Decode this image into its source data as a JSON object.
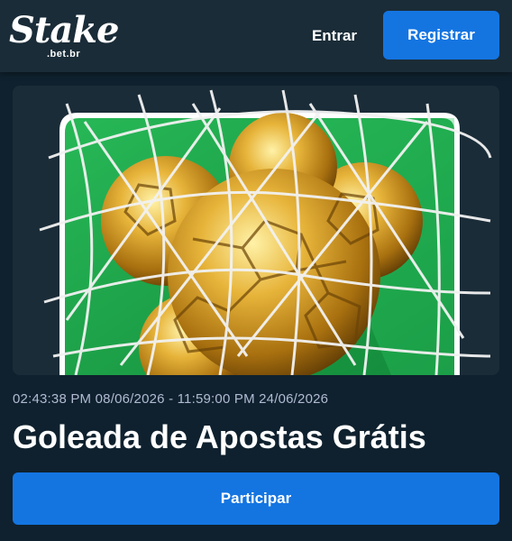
{
  "header": {
    "logo_text": "Stake",
    "logo_subtext": ".bet.br",
    "login_label": "Entrar",
    "register_label": "Registrar"
  },
  "promo": {
    "banner_image": "golden-footballs-in-goal-net",
    "dates": "02:43:38 PM 08/06/2026 - 11:59:00 PM 24/06/2026",
    "title": "Goleada de Apostas Grátis",
    "cta_label": "Participar"
  },
  "colors": {
    "background": "#0f212e",
    "header": "#1a2c38",
    "accent_blue": "#1475e1",
    "banner_green": "#1fa64a",
    "muted_text": "#b1bad3"
  }
}
